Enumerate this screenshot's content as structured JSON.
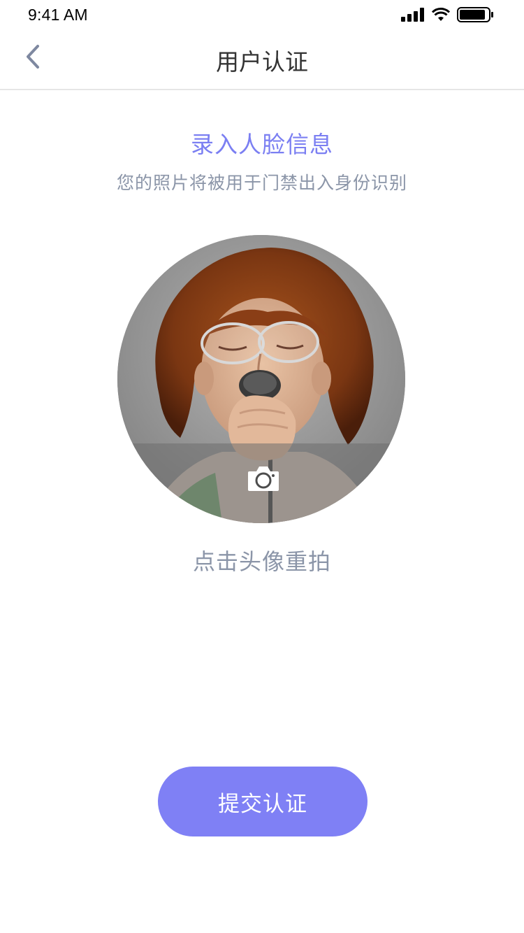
{
  "status_bar": {
    "time": "9:41 AM",
    "icons": [
      "signal-icon",
      "wifi-icon",
      "battery-icon"
    ]
  },
  "nav": {
    "title": "用户认证",
    "back_icon": "chevron-left-icon"
  },
  "content": {
    "heading": "录入人脸信息",
    "subheading": "您的照片将被用于门禁出入身份识别",
    "avatar_overlay_icon": "camera-icon",
    "retake_hint": "点击头像重拍"
  },
  "actions": {
    "submit_label": "提交认证"
  },
  "colors": {
    "accent": "#7f80f5",
    "heading": "#7b7ff2",
    "muted_text": "#8b95a8",
    "title_text": "#333333"
  }
}
